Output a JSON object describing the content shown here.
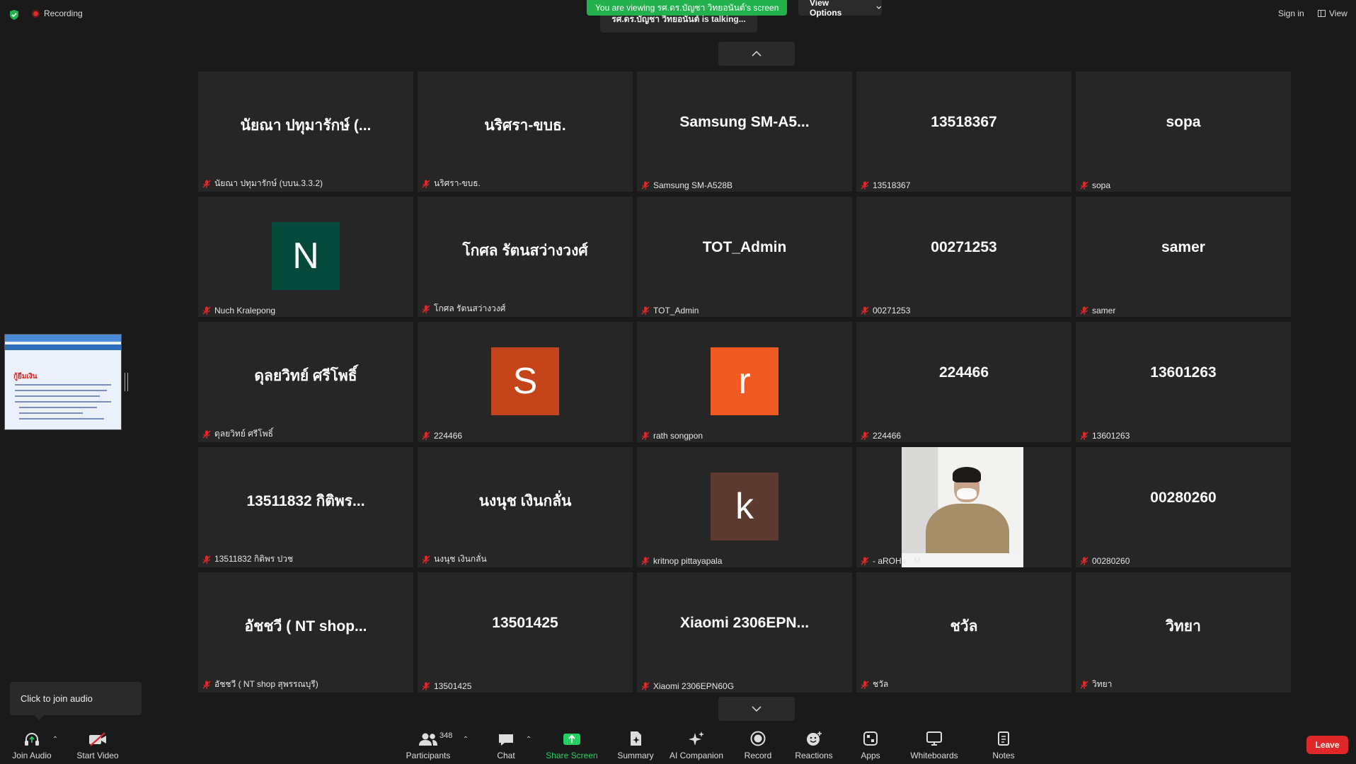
{
  "topbar": {
    "recording": "Recording",
    "viewing_banner": "You are viewing รศ.ดร.บัญชา  วิทยอนันต์'s screen",
    "view_options": "View Options",
    "talking": "รศ.ดร.บัญชา  วิทยอนันต์ is talking...",
    "sign_in": "Sign in",
    "view": "View"
  },
  "tiles": [
    {
      "name": "นัยณา ปทุมารักษ์ (...",
      "label": "นัยณา ปทุมารักษ์ (บบน.3.3.2)"
    },
    {
      "name": "นริศรา-ขบธ.",
      "label": "นริศรา-ขบธ."
    },
    {
      "name": "Samsung  SM-A5...",
      "label": "Samsung SM-A528B"
    },
    {
      "name": "13518367",
      "label": "13518367"
    },
    {
      "name": "sopa",
      "label": "sopa"
    },
    {
      "avatar": "N",
      "avatar_color": "#064a3c",
      "label": "Nuch Kralepong"
    },
    {
      "name": "โกศล รัตนสว่างวงศ์",
      "label": "โกศล รัตนสว่างวงศ์"
    },
    {
      "name": "TOT_Admin",
      "label": "TOT_Admin"
    },
    {
      "name": "00271253",
      "label": "00271253"
    },
    {
      "name": "samer",
      "label": "samer"
    },
    {
      "name": "ดุลยวิทย์ ศรีโพธิ์",
      "label": "ดุลยวิทย์ ศรีโพธิ์"
    },
    {
      "avatar": "S",
      "avatar_color": "#c5441a",
      "label": "224466"
    },
    {
      "avatar": "r",
      "avatar_color": "#f05a22",
      "label": "rath songpon"
    },
    {
      "name": "224466",
      "label": "224466"
    },
    {
      "name": "13601263",
      "label": "13601263"
    },
    {
      "name": "13511832 กิติพร...",
      "label": "13511832 กิติพร ปวช"
    },
    {
      "name": "นงนุช เงินกลั่น",
      "label": "นงนุช เงินกลั่น"
    },
    {
      "avatar": "k",
      "avatar_color": "#5c3a30",
      "label": "kritnop pittayapala"
    },
    {
      "video": true,
      "label": "- aROHa - M"
    },
    {
      "name": "00280260",
      "label": "00280260"
    },
    {
      "name": "อัชชวี  ( NT shop...",
      "label": "อัชชวี  ( NT shop สุพรรณบุรี)"
    },
    {
      "name": "13501425",
      "label": "13501425"
    },
    {
      "name": "Xiaomi  2306EPN...",
      "label": "Xiaomi 2306EPN60G"
    },
    {
      "name": "ชวัล",
      "label": "ชวัล"
    },
    {
      "name": "วิทยา",
      "label": "วิทยา"
    }
  ],
  "thumbnail": {
    "title": "กู้ยืมเงิน"
  },
  "audio_tooltip": "Click to join audio",
  "toolbar": {
    "join_audio": "Join Audio",
    "start_video": "Start Video",
    "participants": "Participants",
    "participant_count": "348",
    "chat": "Chat",
    "share_screen": "Share Screen",
    "summary": "Summary",
    "ai_companion": "AI Companion",
    "record": "Record",
    "reactions": "Reactions",
    "apps": "Apps",
    "whiteboards": "Whiteboards",
    "notes": "Notes",
    "leave": "Leave"
  }
}
